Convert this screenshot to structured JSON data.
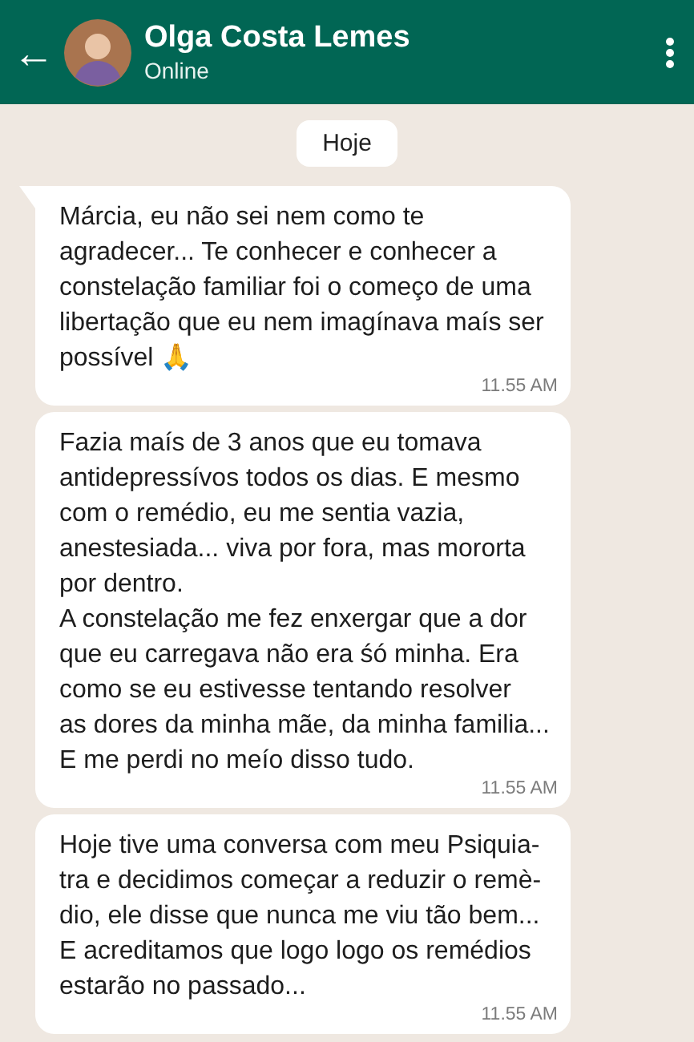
{
  "header": {
    "back_icon": "←",
    "name": "Olga Costa Lemes",
    "status": "Online"
  },
  "date_chip": "Hoje",
  "messages": [
    {
      "text": "Márcia, eu não sei nem como te\nagradecer... Te conhecer e conhecer a\nconstelação familiar foi o começo de uma\nlibertação que eu nem imagínava maís ser\npossível 🙏",
      "time": "11.55 AM",
      "tail": true
    },
    {
      "text": "Fazia maís de 3 anos que eu tomava\nantidepressívos todos os dias. E mesmo\ncom o remédio, eu me sentia vazia,\nanestesiada... viva por fora, mas mororta\npor dentro.\nA constelação me fez enxergar que a dor\nque eu carregava não era śó minha. Era\ncomo se eu estivesse tentando resolver\nas dores da minha mãe, da minha familia...\nE me perdi no meío disso tudo.",
      "time": "11.55 AM",
      "tail": false
    },
    {
      "text": "Hoje tive uma conversa com meu Psiquia-\ntra e decidimos começar a reduzir o remè-\ndio, ele disse que nunca me viu tão bem...\nE acreditamos que logo logo os remédios\nestarão no passado...",
      "time": "11.55 AM",
      "tail": false
    }
  ]
}
